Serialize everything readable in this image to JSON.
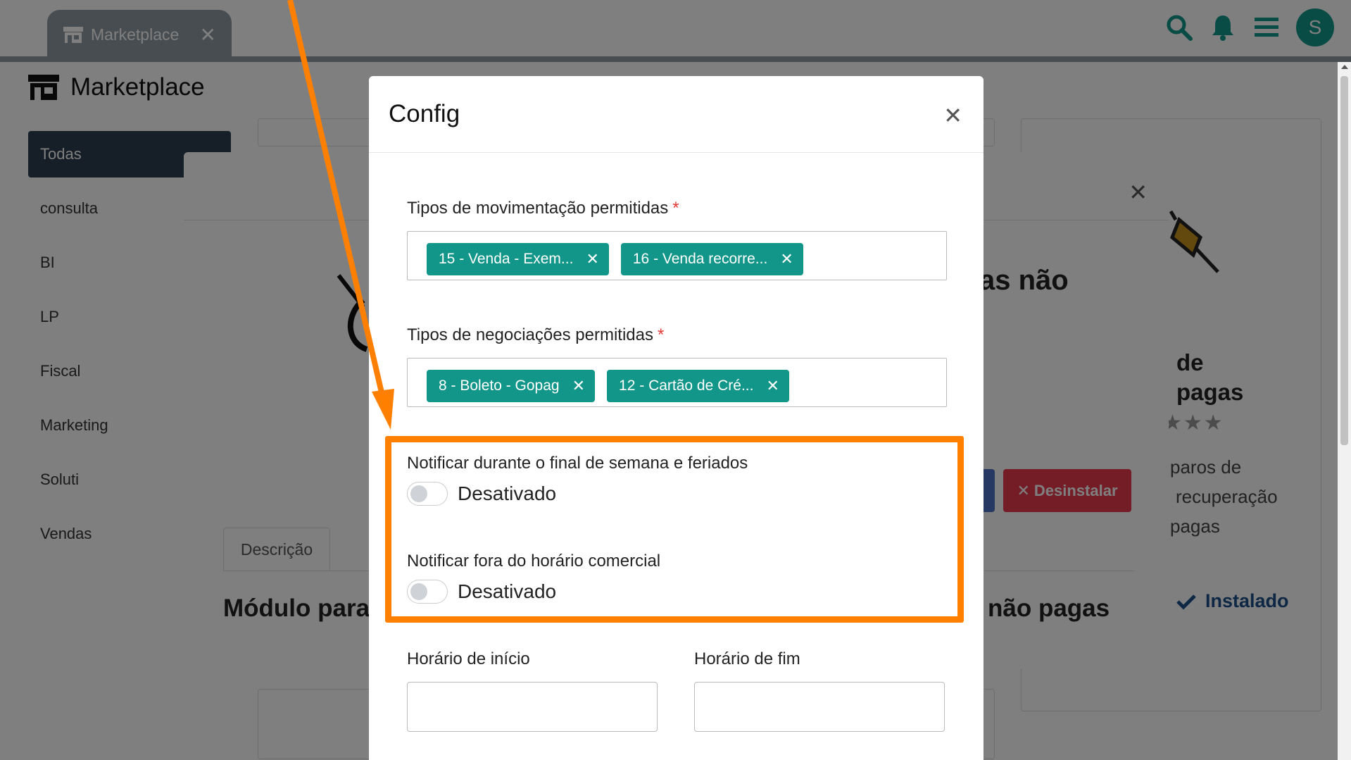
{
  "header": {
    "tab_label": "Marketplace",
    "avatar_letter": "S"
  },
  "page": {
    "title": "Marketplace",
    "categories": [
      "Todas",
      "consulta",
      "BI",
      "LP",
      "Fiscal",
      "Marketing",
      "Soluti",
      "Vendas"
    ]
  },
  "background_modal": {
    "heading_fragment": "as não",
    "desc_tab": "Descrição",
    "module_left": "Módulo para",
    "module_right": "não pagas",
    "uninstall_button": "Desinstalar"
  },
  "background_card": {
    "line1": "de",
    "line2": "pagas",
    "text1": "paros de",
    "text2": "recuperação",
    "text3": "pagas",
    "installed": "Instalado"
  },
  "config": {
    "title": "Config",
    "movimentacao_label": "Tipos de movimentação permitidas",
    "movimentacao_chips": [
      "15 - Venda - Exem...",
      "16 - Venda recorre..."
    ],
    "negociacoes_label": "Tipos de negociações permitidas",
    "negociacoes_chips": [
      "8 - Boleto - Gopag",
      "12 - Cartão de Cré..."
    ],
    "required_mark": "*",
    "weekend_label": "Notificar durante o final de semana e feriados",
    "weekend_state": "Desativado",
    "after_hours_label": "Notificar fora do horário comercial",
    "after_hours_state": "Desativado",
    "start_label": "Horário de início",
    "end_label": "Horário de fim",
    "start_value": "",
    "end_value": ""
  },
  "colors": {
    "accent": "#13968a",
    "annotation": "#ff7f00",
    "danger": "#e83a4f"
  }
}
